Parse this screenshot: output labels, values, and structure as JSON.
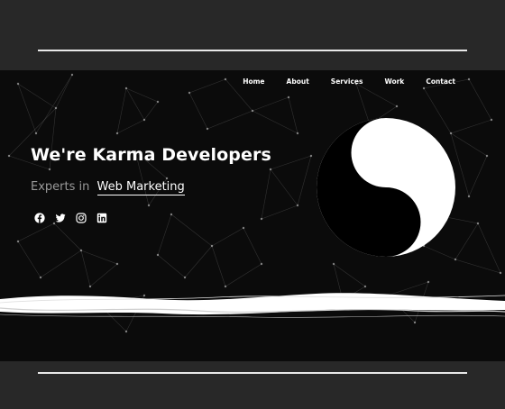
{
  "nav": {
    "items": [
      "Home",
      "About",
      "Services",
      "Work",
      "Contact"
    ]
  },
  "hero": {
    "headline": "We're Karma Developers",
    "sub_prefix": "Experts in",
    "sub_highlight": "Web Marketing"
  },
  "social": {
    "icons": [
      "facebook-icon",
      "twitter-icon",
      "instagram-icon",
      "linkedin-icon"
    ]
  },
  "colors": {
    "page_background": "#282828",
    "hero_background": "#0b0b0b",
    "text": "#ffffff",
    "muted_text": "#9a9a9a"
  }
}
